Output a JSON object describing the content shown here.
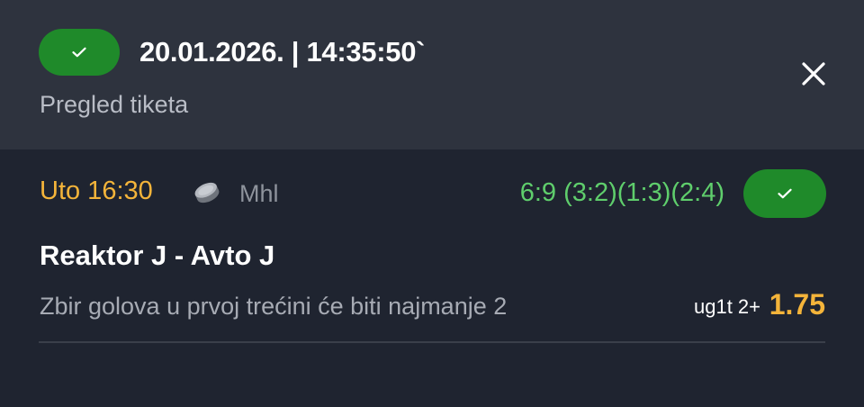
{
  "header": {
    "datetime": "20.01.2026. | 14:35:50`",
    "subtitle": "Pregled tiketa",
    "status_icon": "check-icon",
    "close_icon": "close-icon"
  },
  "event": {
    "time": "Uto 16:30",
    "sport_icon": "hockey-puck-icon",
    "league": "Mhl",
    "result": "6:9 (3:2)(1:3)(2:4)",
    "status_icon": "check-icon",
    "match": "Reaktor J - Avto J",
    "market": "Zbir golova u prvoj trećini će biti najmanje 2",
    "pick_code": "ug1t 2+",
    "odd": "1.75"
  },
  "colors": {
    "header_bg": "#2e333e",
    "body_bg": "#1f2430",
    "win_green": "#1f8a2a",
    "result_green": "#5fce6c",
    "accent_orange": "#f4b43a"
  }
}
